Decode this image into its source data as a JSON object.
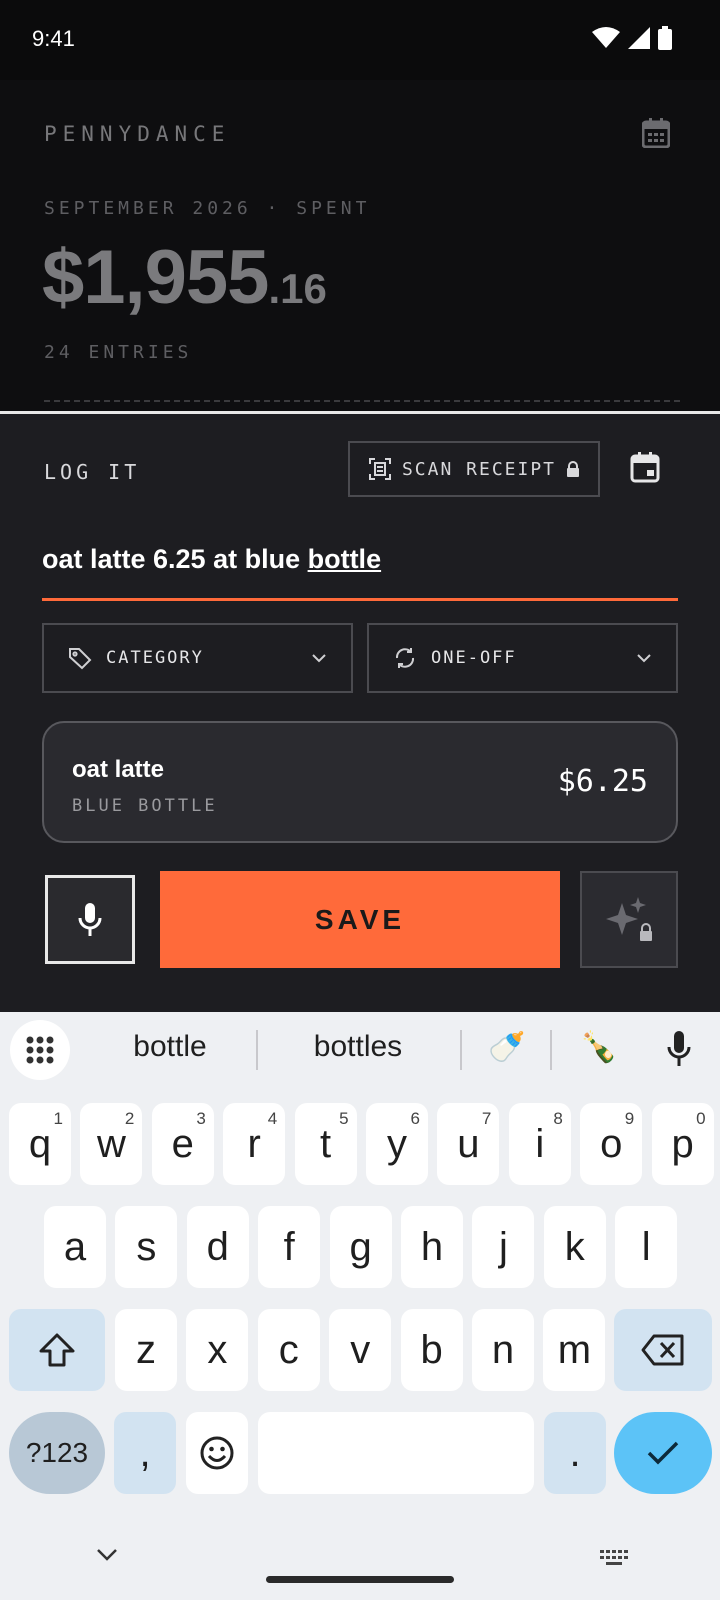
{
  "status": {
    "time": "9:41"
  },
  "header": {
    "brand": "PENNYDANCE",
    "period_label": "SEPTEMBER 2026 · SPENT",
    "amount_main": "$1,955",
    "amount_cents": ".16",
    "entries_label": "24 ENTRIES"
  },
  "sheet": {
    "title": "LOG IT",
    "scan_label": "SCAN RECEIPT",
    "input_text_before": "oat latte 6.25 at blue ",
    "input_text_word": "bottle",
    "category_label": "CATEGORY",
    "repeat_label": "ONE-OFF",
    "preview": {
      "name": "oat latte",
      "vendor": "BLUE BOTTLE",
      "amount": "$6.25"
    },
    "save_label": "SAVE"
  },
  "keyboard": {
    "suggestions": [
      "bottle",
      "bottles",
      "🍼",
      "🍾"
    ],
    "row1": [
      {
        "k": "q",
        "h": "1"
      },
      {
        "k": "w",
        "h": "2"
      },
      {
        "k": "e",
        "h": "3"
      },
      {
        "k": "r",
        "h": "4"
      },
      {
        "k": "t",
        "h": "5"
      },
      {
        "k": "y",
        "h": "6"
      },
      {
        "k": "u",
        "h": "7"
      },
      {
        "k": "i",
        "h": "8"
      },
      {
        "k": "o",
        "h": "9"
      },
      {
        "k": "p",
        "h": "0"
      }
    ],
    "row2": [
      "a",
      "s",
      "d",
      "f",
      "g",
      "h",
      "j",
      "k",
      "l"
    ],
    "row3": [
      "z",
      "x",
      "c",
      "v",
      "b",
      "n",
      "m"
    ],
    "symbols_label": "?123",
    "comma": ",",
    "period": ".",
    "colors": {
      "accent": "#ff6a3a",
      "enter": "#5cc3f7"
    }
  }
}
